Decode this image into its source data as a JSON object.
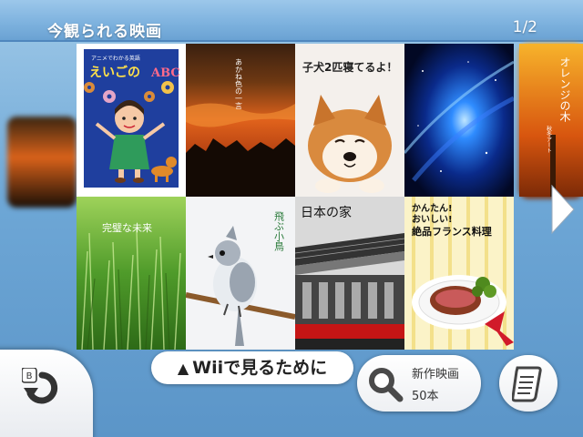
{
  "header": {
    "title": "今観られる映画",
    "page_indicator": "1/2"
  },
  "tiles": [
    {
      "title": "えいごの ABC",
      "subtitle": "アニメでわかる英語",
      "abc": "ABC"
    },
    {
      "title": "あかね色の一言"
    },
    {
      "title": "子犬2匹寝てるよ！"
    },
    {
      "title": ""
    },
    {
      "title": "オレンジの木",
      "subtitle": "秋冬アート"
    },
    {
      "title": "完璧な未来"
    },
    {
      "title": "飛ぶ小鳥"
    },
    {
      "title": "日本の家"
    },
    {
      "title_line1": "かんたん!",
      "title_line2": "おいしい!",
      "title_line3": "絶品フランス料理"
    }
  ],
  "footer": {
    "wii_label": "Wiiで見るために",
    "wii_icon": "up-triangle",
    "search_line1": "新作映画",
    "search_line2": "50本",
    "back_key": "B",
    "back_icon": "back-arrow-icon",
    "menu_icon": "document-list-icon"
  },
  "colors": {
    "accent": "#5b95c8",
    "header": "#7fb3df",
    "button_bg": "#ffffff"
  }
}
